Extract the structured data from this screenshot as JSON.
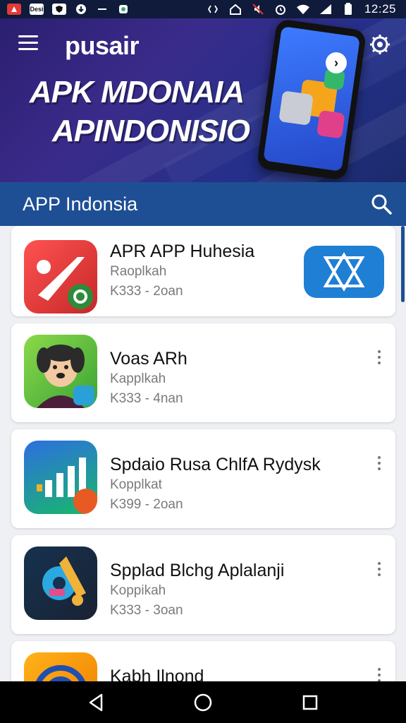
{
  "status_bar": {
    "left_icons": [
      "app-notification-icon",
      "news-notification-icon",
      "shield-notification-icon",
      "download-notification-icon",
      "minus-icon",
      "vpn-notification-icon"
    ],
    "left_box_labels": [
      "",
      "Desi",
      ""
    ],
    "right_icons": [
      "data-arrows-icon",
      "home-icon",
      "mute-icon",
      "alarm-icon",
      "wifi-icon",
      "signal-icon",
      "battery-icon"
    ],
    "time": "12:25"
  },
  "hero": {
    "logo": "pusair",
    "title_line1": "APK MDONAIA",
    "title_line2": "APINDONISIO",
    "colors": {
      "bg_start": "#2b1f70",
      "bg_end": "#1b2a6a"
    }
  },
  "header": {
    "title": "APP Indonsia",
    "search_icon": "search-icon"
  },
  "apps": [
    {
      "name": "APR APP Huhesia",
      "category": "Raoplkah",
      "meta": "K333 - 2oan",
      "icon": "red-app-icon",
      "action": "install-button"
    },
    {
      "name": "Voas ARh",
      "category": "Kapplkah",
      "meta": "K333 - 4nan",
      "icon": "dog-avatar-app-icon",
      "action": "more-options"
    },
    {
      "name": "Spdaio Rusa ChlfA Rydysk",
      "category": "Kopplkat",
      "meta": "K399 - 2oan",
      "icon": "bar-chart-app-icon",
      "action": "more-options"
    },
    {
      "name": "Spplad Blchg Aplalanji",
      "category": "Koppikah",
      "meta": "K333 - 3oan",
      "icon": "gear-tool-app-icon",
      "action": "more-options"
    },
    {
      "name": "Kabh Ilnond",
      "category": "",
      "meta": "",
      "icon": "target-app-icon",
      "action": "more-options"
    }
  ],
  "nav": {
    "back": "back-icon",
    "home": "home-circle-icon",
    "recents": "recents-square-icon"
  },
  "colors": {
    "accent": "#1e4f94",
    "install": "#1f7fd4"
  }
}
